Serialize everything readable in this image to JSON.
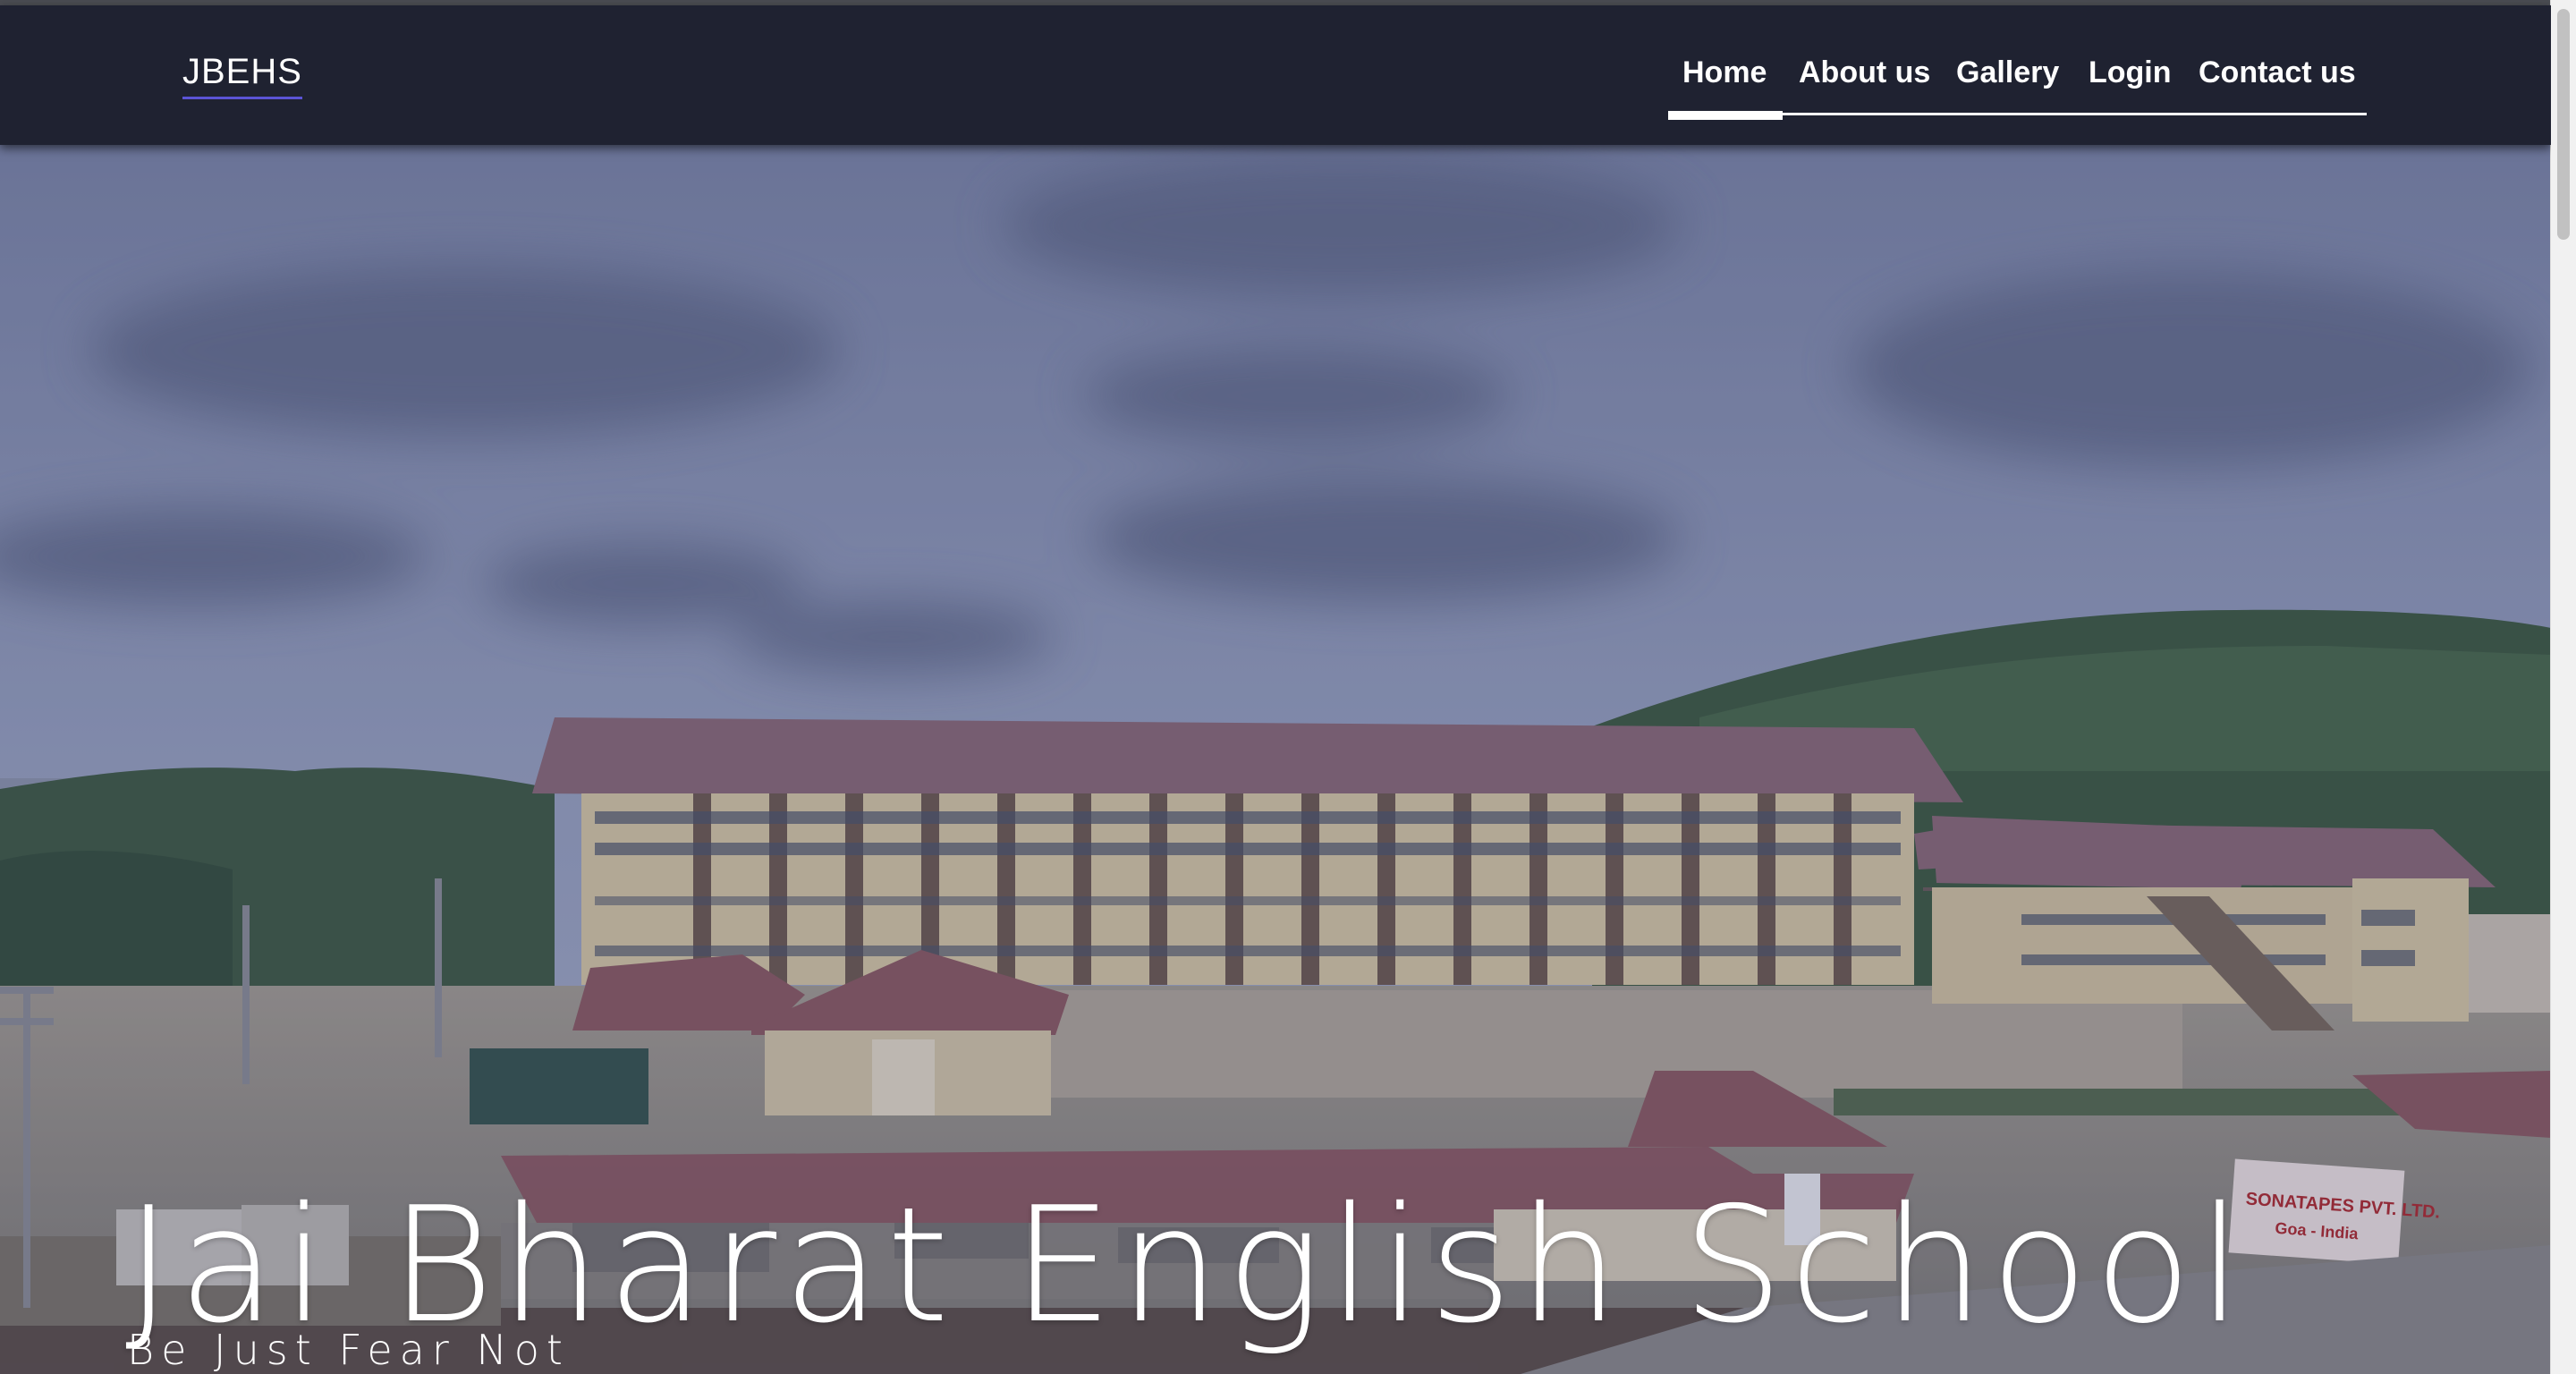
{
  "brand": {
    "name": "JBEHS"
  },
  "nav": {
    "items": [
      {
        "label": "Home",
        "active": true
      },
      {
        "label": "About us",
        "active": false
      },
      {
        "label": "Gallery",
        "active": false
      },
      {
        "label": "Login",
        "active": false
      },
      {
        "label": "Contact us",
        "active": false
      }
    ]
  },
  "hero": {
    "title": "Jai Bharat English School",
    "tagline": "Be Just Fear Not",
    "sign_text_1": "SONATAPES PVT. LTD.",
    "sign_text_2": "Goa - India"
  },
  "colors": {
    "navbar": "#1f2231",
    "brand_underline": "#5b54d6",
    "text": "#ffffff"
  }
}
